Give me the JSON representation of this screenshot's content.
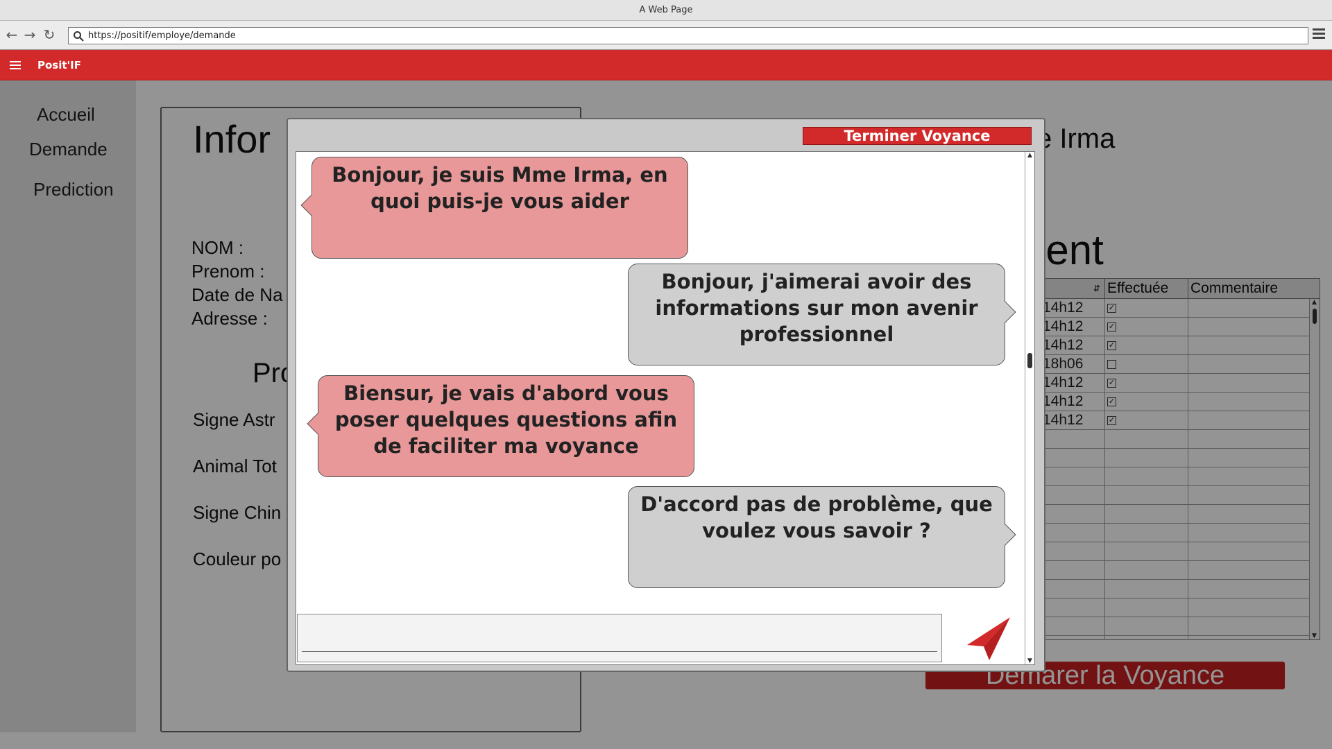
{
  "browser": {
    "window_title": "A Web Page",
    "url": "https://positif/employe/demande"
  },
  "app": {
    "title": "Posit'IF"
  },
  "sidebar": {
    "items": [
      {
        "label": "Accueil"
      },
      {
        "label": "Demande"
      },
      {
        "label": "Prediction"
      }
    ]
  },
  "info_panel": {
    "title_fragment": "Infor",
    "fields": [
      "NOM :",
      "Prenom :",
      "Date de Na",
      "Adresse :"
    ],
    "profile_title_fragment": "Pro",
    "profile_fields": [
      "Signe Astr",
      "Animal Tot",
      "Signe Chin",
      "Couleur po"
    ]
  },
  "right_panel": {
    "medium_title_fragment": "e Irma",
    "client_title_fragment": "ient"
  },
  "history_table": {
    "headers": [
      "",
      "Effectuée",
      "Commentaire"
    ],
    "rows": [
      {
        "time": "14h12",
        "done": "☑"
      },
      {
        "time": "14h12",
        "done": "☑"
      },
      {
        "time": "14h12",
        "done": "☑"
      },
      {
        "time": "18h06",
        "done": "☐"
      },
      {
        "time": "14h12",
        "done": "☑"
      },
      {
        "time": "14h12",
        "done": "☑"
      },
      {
        "time": "14h12",
        "done": "☑"
      }
    ]
  },
  "start_button": {
    "label": "Démarer la Voyance"
  },
  "modal": {
    "end_button_label": "Terminer Voyance",
    "messages": [
      {
        "side": "left",
        "text": "Bonjour, je suis Mme Irma, en quoi puis-je vous aider"
      },
      {
        "side": "right",
        "text": "Bonjour, j'aimerai avoir des informations sur mon avenir professionnel"
      },
      {
        "side": "left",
        "text": "Biensur, je vais d'abord vous poser quelques questions afin de faciliter ma voyance"
      },
      {
        "side": "right",
        "text": "D'accord pas de problème, que voulez vous savoir ?"
      }
    ],
    "input_value": "",
    "send_icon": "paper-plane-icon"
  },
  "colors": {
    "accent": "#d22a2a",
    "bubble_left": "#e89898",
    "bubble_right": "#cfcfcf"
  }
}
